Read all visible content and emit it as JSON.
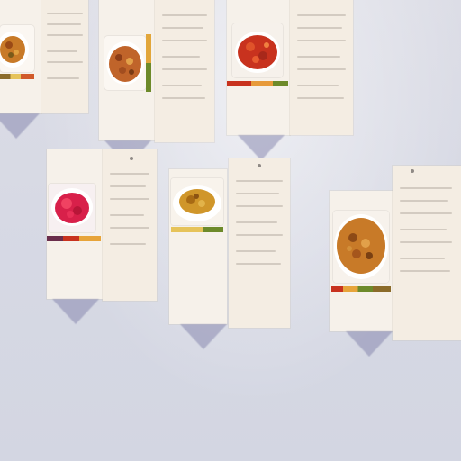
{
  "scene": {
    "description_colors": {
      "wall": "#d8dae4",
      "paper": "#f4ede3",
      "shadow": "#7878a5",
      "sauce_red": "#c8321e",
      "fried_orange": "#c87a28",
      "green": "#6d8a2a",
      "magenta": "#d8204a"
    }
  }
}
